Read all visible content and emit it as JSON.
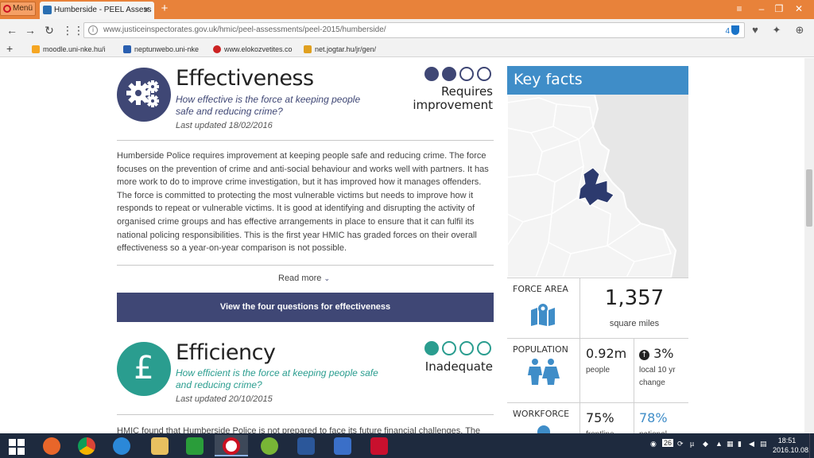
{
  "browser": {
    "menu_label": "Menü",
    "tab_title": "Humberside - PEEL Assess",
    "url": "www.justiceinspectorates.gov.uk/hmic/peel-assessments/peel-2015/humberside/",
    "blocked_count": "4",
    "bookmarks": [
      {
        "label": "moodle.uni-nke.hu/i",
        "icon": "moodle-icon",
        "color": "#f5a623"
      },
      {
        "label": "neptunwebo.uni-nke",
        "icon": "neptun-icon",
        "color": "#2a5fb0"
      },
      {
        "label": "www.elokozvetites.co",
        "icon": "globe-icon",
        "color": "#cc2222"
      },
      {
        "label": "net.jogtar.hu/jr/gen/",
        "icon": "jogtar-icon",
        "color": "#e0a020"
      }
    ]
  },
  "effectiveness": {
    "title": "Effectiveness",
    "question": "How effective is the force at keeping people safe and reducing crime?",
    "updated": "Last updated 18/02/2016",
    "grade_line1": "Requires",
    "grade_line2": "improvement",
    "grade_level": 2,
    "grade_total": 4,
    "color": "#3f4775",
    "body": "Humberside Police requires improvement at keeping people safe and reducing crime. The force focuses on the prevention of crime and anti-social behaviour and works well with partners. It has more work to do to improve crime investigation, but it has improved how it manages offenders. The force is committed to protecting the most vulnerable victims but needs to improve how it responds to repeat or vulnerable victims. It is good at identifying and disrupting the activity of organised crime groups and has effective arrangements in place to ensure that it can fulfil its national policing responsibilities. This is the first year HMIC has graded forces on their overall effectiveness so a year-on-year comparison is not possible.",
    "read_more": "Read more",
    "cta": "View the four questions for effectiveness"
  },
  "efficiency": {
    "title": "Efficiency",
    "question": "How efficient is the force at keeping people safe and reducing crime?",
    "updated": "Last updated 20/10/2015",
    "grade": "Inadequate",
    "grade_level": 1,
    "grade_total": 4,
    "color": "#2a9d8f",
    "body_start": "HMIC found that Humberside Police is not prepared to face its future financial challenges. The"
  },
  "key_facts": {
    "title": "Key facts",
    "force_area_label": "FORCE AREA",
    "force_area_value": "1,357",
    "force_area_unit": "square miles",
    "population_label": "POPULATION",
    "population_value": "0.92m",
    "population_unit": "people",
    "population_change": "3%",
    "population_change_label": "local 10 yr change",
    "workforce_label": "WORKFORCE",
    "workforce_value1": "75%",
    "workforce_label1": "frontline",
    "workforce_value2": "78%",
    "workforce_label2": "national"
  },
  "taskbar": {
    "clock_time": "18:51",
    "clock_date": "2016.10.08.",
    "tray_badge": "26"
  }
}
